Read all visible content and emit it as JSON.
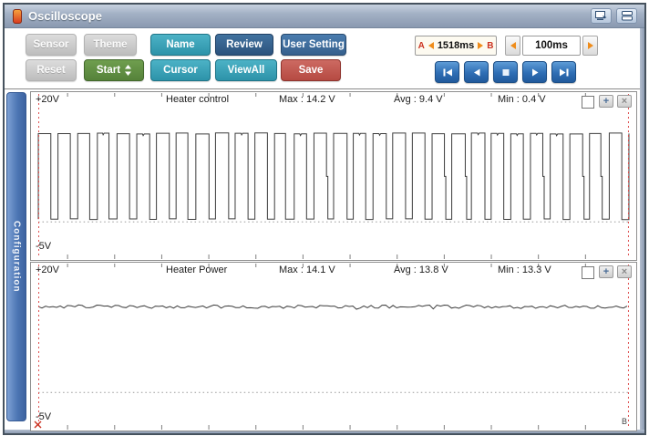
{
  "window": {
    "title": "Oscilloscope"
  },
  "icons": {
    "plus_glyph": "+",
    "close_glyph": "×"
  },
  "toolbar": {
    "rows": [
      [
        {
          "label": "Sensor",
          "style": "gray"
        },
        {
          "label": "Theme",
          "style": "gray"
        },
        {
          "label": "Name",
          "style": "teal"
        },
        {
          "label": "Review",
          "style": "navy"
        },
        {
          "label": "User Setting",
          "style": "steel"
        }
      ],
      [
        {
          "label": "Reset",
          "style": "gray"
        },
        {
          "label": "Start",
          "style": "green"
        },
        {
          "label": "Cursor",
          "style": "teal"
        },
        {
          "label": "ViewAll",
          "style": "teal"
        },
        {
          "label": "Save",
          "style": "red"
        }
      ]
    ]
  },
  "time_controls": {
    "ab_box": {
      "a_label": "A",
      "b_label": "B",
      "value": "1518ms"
    },
    "interval": {
      "value": "100ms"
    }
  },
  "playback": {
    "buttons": [
      "skip-to-start",
      "step-back",
      "stop",
      "play",
      "skip-to-end"
    ]
  },
  "sidebar": {
    "label": "Configuration"
  },
  "colors": {
    "teal": "#2d93a9",
    "navy": "#2c537d",
    "steel": "#36608d",
    "green": "#55823a",
    "red": "#b54a42",
    "playback_blue": "#2f6eb4",
    "sidebar_blue": "#4d76b4",
    "cursor_red": "#e05050",
    "orange_arrow": "#ef8c1a",
    "titlebar": "#8a99b0"
  },
  "chart_data": [
    {
      "type": "line",
      "title": "Heater control",
      "ytop_label": "+20V",
      "ybottom_label": "-5V",
      "ylim": [
        -5,
        20
      ],
      "stats": {
        "max_v": 14.2,
        "avg_v": 9.4,
        "min_v": 0.4
      },
      "stats_display": [
        "Max : 14.2 V",
        "Avg : 9.4 V",
        "Min : 0.4 V"
      ],
      "signal": {
        "kind": "pwm",
        "high": 14.2,
        "low": 0.4,
        "cycles": 30,
        "duty": 0.62,
        "seed": 11
      }
    },
    {
      "type": "line",
      "title": "Heater Power",
      "ytop_label": "+20V",
      "ybottom_label": "-5V",
      "ylim": [
        -5,
        20
      ],
      "stats": {
        "max_v": 14.1,
        "avg_v": 13.8,
        "min_v": 13.3
      },
      "stats_display": [
        "Max : 14.1 V",
        "Avg : 13.8 V",
        "Min : 13.3 V"
      ],
      "signal": {
        "kind": "noisy",
        "mean": 13.8,
        "noise": 0.55,
        "seed": 23
      },
      "cursor_b_label": "B"
    }
  ]
}
